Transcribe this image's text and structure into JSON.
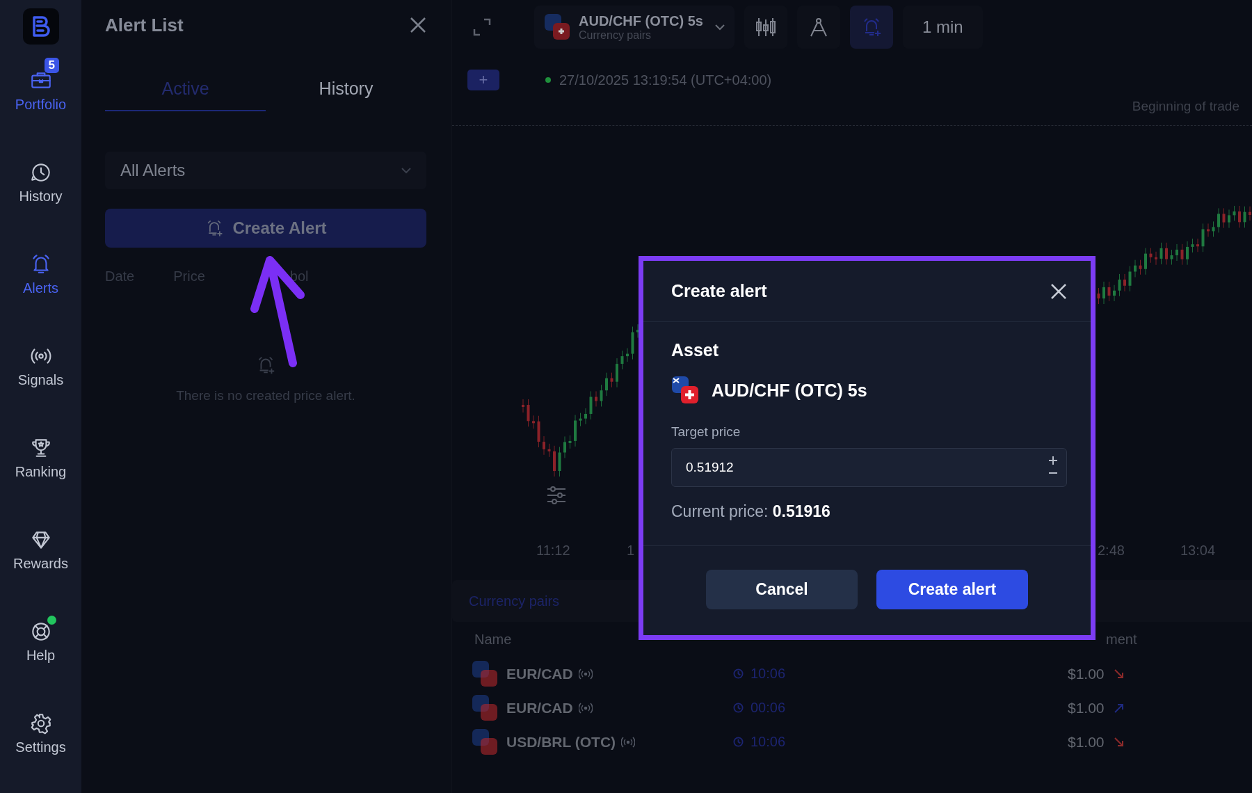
{
  "sidebar": {
    "items": [
      {
        "label": "Portfolio",
        "selected": true,
        "badge": "5",
        "notification": false
      },
      {
        "label": "History",
        "selected": false,
        "notification": false
      },
      {
        "label": "Alerts",
        "selected": true,
        "notification": false
      },
      {
        "label": "Signals",
        "selected": false,
        "notification": false
      },
      {
        "label": "Ranking",
        "selected": false,
        "notification": false
      },
      {
        "label": "Rewards",
        "selected": false,
        "notification": false
      },
      {
        "label": "Help",
        "selected": false,
        "notification": true
      },
      {
        "label": "Settings",
        "selected": false,
        "notification": false
      }
    ]
  },
  "alert_panel": {
    "title": "Alert List",
    "tabs": [
      {
        "label": "Active",
        "selected": true
      },
      {
        "label": "History",
        "selected": false
      }
    ],
    "filter": {
      "value": "All Alerts"
    },
    "create_button": "Create Alert",
    "columns": [
      "Date",
      "Price",
      "bol"
    ],
    "empty_message": "There is no created price alert."
  },
  "chart": {
    "asset": {
      "name": "AUD/CHF (OTC) 5s",
      "category": "Currency pairs"
    },
    "alerts_active": true,
    "timeframe": "1 min",
    "add_button": "+",
    "timestamp": "27/10/2025 13:19:54 (UTC+04:00)",
    "trade_label": "Beginning of trade",
    "time_labels": [
      "11:12",
      "1",
      "2:48",
      "13:04"
    ]
  },
  "trades": {
    "tab": "Currency pairs",
    "columns": [
      "Name",
      "ment"
    ],
    "rows": [
      {
        "name": "EUR/CAD",
        "time": "10:06",
        "amount": "$1.00",
        "rising": false
      },
      {
        "name": "EUR/CAD",
        "time": "00:06",
        "amount": "$1.00",
        "rising": true
      },
      {
        "name": "USD/BRL (OTC)",
        "time": "10:06",
        "amount": "$1.00",
        "rising": false
      }
    ]
  },
  "dialog": {
    "title": "Create alert",
    "section": "Asset",
    "asset": "AUD/CHF (OTC) 5s",
    "target_label": "Target price",
    "target_value": "0.51912",
    "current_price": "Current price: **0.51916**",
    "buttons": [
      {
        "label": "Cancel",
        "kind": "secondary"
      },
      {
        "label": "Create alert",
        "kind": "primary"
      }
    ]
  }
}
